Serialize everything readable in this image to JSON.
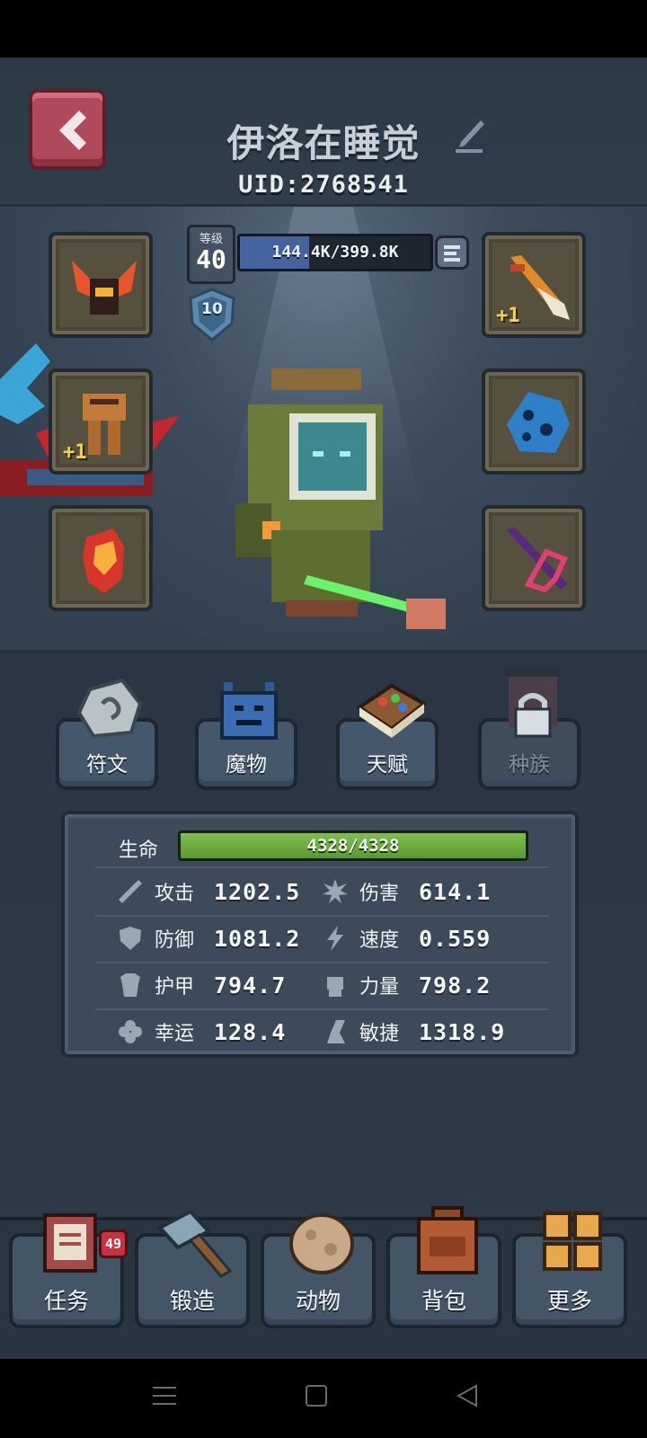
{
  "header": {
    "back_icon": "chevron-left-icon",
    "player_name": "伊洛在睡觉",
    "edit_icon": "quill-edit-icon",
    "uid": "UID:2768541"
  },
  "level": {
    "label": "等级",
    "value": "40",
    "xp_text": "144.4K/399.8K",
    "xp_current": 144.4,
    "xp_max": 399.8,
    "rank": "10"
  },
  "equipment": {
    "left": [
      {
        "name": "helmet",
        "icon": "flame-horned-helmet-icon",
        "plus": ""
      },
      {
        "name": "armor",
        "icon": "bronze-armor-icon",
        "plus": "+1"
      },
      {
        "name": "gloves",
        "icon": "fire-gauntlet-icon",
        "plus": ""
      }
    ],
    "right": [
      {
        "name": "weapon",
        "icon": "flame-sword-icon",
        "plus": "+1"
      },
      {
        "name": "shield",
        "icon": "blue-crystal-shield-icon",
        "plus": ""
      },
      {
        "name": "offhand",
        "icon": "purple-crossbow-icon",
        "plus": ""
      }
    ]
  },
  "tabs": [
    {
      "label": "符文",
      "icon": "rune-stone-icon",
      "locked": false
    },
    {
      "label": "魔物",
      "icon": "blue-monster-icon",
      "locked": false
    },
    {
      "label": "天赋",
      "icon": "talent-book-icon",
      "locked": false
    },
    {
      "label": "种族",
      "icon": "lock-icon",
      "locked": true
    }
  ],
  "stats": {
    "hp_label": "生命",
    "hp_text": "4328/4328",
    "hp_current": 4328,
    "hp_max": 4328,
    "items": [
      {
        "label": "攻击",
        "value": "1202.5",
        "icon": "sword-icon"
      },
      {
        "label": "伤害",
        "value": "614.1",
        "icon": "burst-icon"
      },
      {
        "label": "防御",
        "value": "1081.2",
        "icon": "shield-icon"
      },
      {
        "label": "速度",
        "value": "0.559",
        "icon": "lightning-icon"
      },
      {
        "label": "护甲",
        "value": "794.7",
        "icon": "armor-icon"
      },
      {
        "label": "力量",
        "value": "798.2",
        "icon": "fist-icon"
      },
      {
        "label": "幸运",
        "value": "128.4",
        "icon": "clover-icon"
      },
      {
        "label": "敏捷",
        "value": "1318.9",
        "icon": "boot-icon"
      }
    ]
  },
  "nav": [
    {
      "label": "任务",
      "icon": "quest-book-icon",
      "badge": "49"
    },
    {
      "label": "锻造",
      "icon": "hammer-icon",
      "badge": ""
    },
    {
      "label": "动物",
      "icon": "egg-icon",
      "badge": ""
    },
    {
      "label": "背包",
      "icon": "backpack-icon",
      "badge": ""
    },
    {
      "label": "更多",
      "icon": "grid-icon",
      "badge": ""
    }
  ],
  "system_nav": {
    "menu_icon": "menu-icon",
    "home_icon": "home-square-icon",
    "back_icon": "back-triangle-icon"
  },
  "colors": {
    "background": "#2f3b49",
    "back_button": "#b0495a",
    "xp_fill": "#4563a0",
    "hp_fill": "#6aad40",
    "plus_text": "#f4d24a",
    "badge": "#c8323d"
  }
}
